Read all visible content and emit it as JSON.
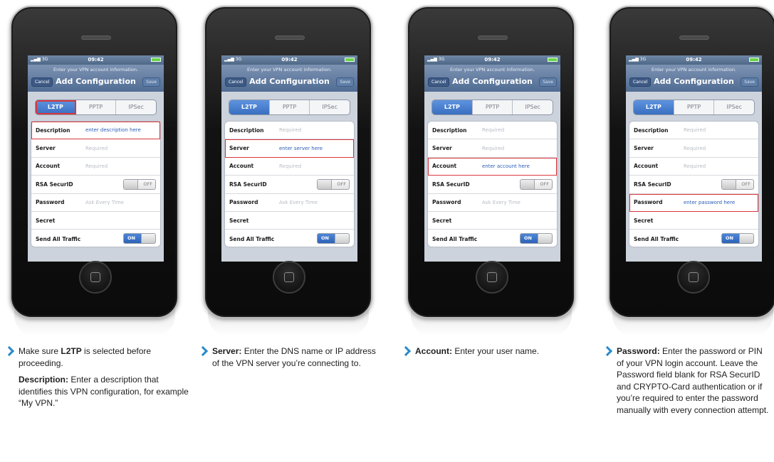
{
  "screen": {
    "carrier": "3G",
    "time": "09:42",
    "prompt": "Enter your VPN account information.",
    "cancel_label": "Cancel",
    "title": "Add Configuration",
    "save_label": "Save",
    "protocols": [
      "L2TP",
      "PPTP",
      "IPSec"
    ],
    "selected_protocol": "L2TP",
    "labels": {
      "description": "Description",
      "server": "Server",
      "account": "Account",
      "rsa": "RSA SecurID",
      "password": "Password",
      "secret": "Secret",
      "send_all": "Send All Traffic"
    },
    "placeholders": {
      "required": "Required",
      "ask_every_time": "Ask Every Time"
    },
    "toggle_off": "OFF",
    "toggle_on": "ON"
  },
  "panels": [
    {
      "highlighted_field": "description",
      "entered_text": "enter description here",
      "caption": {
        "p1_pre": "Make sure ",
        "p1_bold": "L2TP",
        "p1_post": " is selected before proceeding.",
        "p2_bold": "Description:",
        "p2_text": " Enter a description that identifies this VPN configuration, for example “My VPN.”"
      }
    },
    {
      "highlighted_field": "server",
      "entered_text": "enter server here",
      "caption": {
        "bold": "Server:",
        "text": " Enter the DNS name or IP address of the VPN server you’re connecting to."
      }
    },
    {
      "highlighted_field": "account",
      "entered_text": "enter account here",
      "caption": {
        "bold": "Account:",
        "text": " Enter your user name."
      }
    },
    {
      "highlighted_field": "password",
      "entered_text": "enter password here",
      "caption": {
        "bold": "Password:",
        "text": " Enter the password or PIN of your VPN login account. Leave the Password field blank for RSA SecurID and CRYPTO-Card authentication or if you’re required to enter the password manually with every connection attempt."
      }
    }
  ]
}
